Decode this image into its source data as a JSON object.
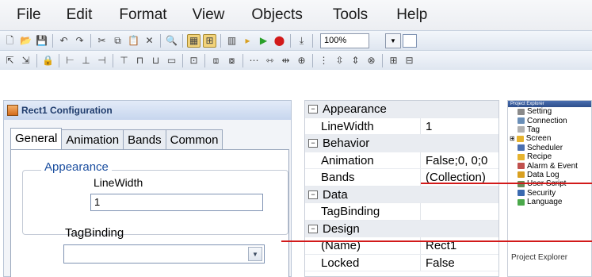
{
  "menu": [
    "File",
    "Edit",
    "Format",
    "View",
    "Objects",
    "Tools",
    "Help"
  ],
  "toolbar": {
    "zoom": "100%"
  },
  "config": {
    "title": "Rect1 Configuration",
    "tabs": [
      "General",
      "Animation",
      "Bands",
      "Common"
    ],
    "group_title": "Appearance",
    "linewidth_label": "LineWidth",
    "linewidth_value": "1",
    "tagbinding_label": "TagBinding",
    "tagbinding_value": ""
  },
  "properties": [
    {
      "type": "category",
      "name": "Appearance"
    },
    {
      "type": "prop",
      "name": "LineWidth",
      "value": "1"
    },
    {
      "type": "category",
      "name": "Behavior"
    },
    {
      "type": "prop",
      "name": "Animation",
      "value": "False;0, 0;0"
    },
    {
      "type": "prop",
      "name": "Bands",
      "value": "(Collection)"
    },
    {
      "type": "category",
      "name": "Data"
    },
    {
      "type": "prop",
      "name": "TagBinding",
      "value": ""
    },
    {
      "type": "category",
      "name": "Design"
    },
    {
      "type": "prop",
      "name": "(Name)",
      "value": "Rect1"
    },
    {
      "type": "prop",
      "name": "Locked",
      "value": "False"
    }
  ],
  "explorer": {
    "header": "Project Explorer",
    "items": [
      {
        "label": "Setting",
        "icon": "wrench-icon",
        "color": "#8a8a8a"
      },
      {
        "label": "Connection",
        "icon": "network-icon",
        "color": "#6a8fb8"
      },
      {
        "label": "Tag",
        "icon": "tag-icon",
        "color": "#b0b0b0"
      },
      {
        "label": "Screen",
        "icon": "folder-icon",
        "color": "#e6b32e"
      },
      {
        "label": "Scheduler",
        "icon": "scheduler-icon",
        "color": "#4a6fb0"
      },
      {
        "label": "Recipe",
        "icon": "recipe-icon",
        "color": "#e6b32e"
      },
      {
        "label": "Alarm & Event",
        "icon": "alarm-icon",
        "color": "#c0504d"
      },
      {
        "label": "Data Log",
        "icon": "datalog-icon",
        "color": "#d9a020"
      },
      {
        "label": "User Script",
        "icon": "script-icon",
        "color": "#6a8a5a"
      },
      {
        "label": "Security",
        "icon": "security-icon",
        "color": "#3a6ab0"
      },
      {
        "label": "Language",
        "icon": "language-icon",
        "color": "#4aa84a"
      }
    ],
    "footer": "Project Explorer"
  }
}
